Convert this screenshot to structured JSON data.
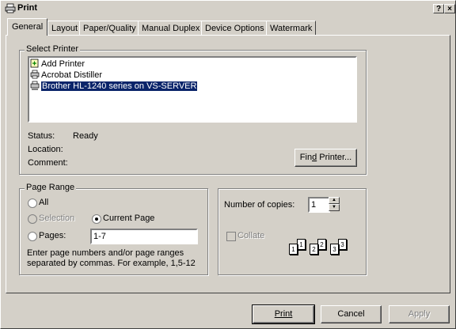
{
  "window": {
    "title": "Print",
    "help_label": "?",
    "close_label": "×"
  },
  "tabs": [
    {
      "label": "General",
      "active": true
    },
    {
      "label": "Layout"
    },
    {
      "label": "Paper/Quality"
    },
    {
      "label": "Manual Duplex"
    },
    {
      "label": "Device Options"
    },
    {
      "label": "Watermark"
    }
  ],
  "select_printer": {
    "legend": "Select Printer",
    "printers": [
      {
        "name": "Add Printer",
        "icon": "add-printer-icon"
      },
      {
        "name": "Acrobat Distiller",
        "icon": "printer-icon"
      },
      {
        "name": "Brother HL-1240 series on VS-SERVER",
        "icon": "network-printer-icon",
        "selected": true
      }
    ],
    "status_label": "Status:",
    "status_value": "Ready",
    "location_label": "Location:",
    "location_value": "",
    "comment_label": "Comment:",
    "comment_value": "",
    "find_printer_pre": "Fin",
    "find_printer_key": "d",
    "find_printer_post": " Printer..."
  },
  "page_range": {
    "legend": "Page Range",
    "all_label": "All",
    "selection_label": "Selection",
    "current_page_label": "Current Page",
    "pages_label": "Pages:",
    "pages_value": "1-7",
    "help_line1": "Enter page numbers and/or page ranges",
    "help_line2": "separated by commas.  For example, 1,5-12",
    "selected": "current_page"
  },
  "copies": {
    "number_label": "Number of copies:",
    "number_value": "1",
    "collate_label": "Collate",
    "collate_checked": false,
    "page_digits": [
      "1",
      "1",
      "2",
      "2",
      "3",
      "3"
    ]
  },
  "footer": {
    "print_label": "Print",
    "cancel_label": "Cancel",
    "apply_label": "Apply"
  }
}
